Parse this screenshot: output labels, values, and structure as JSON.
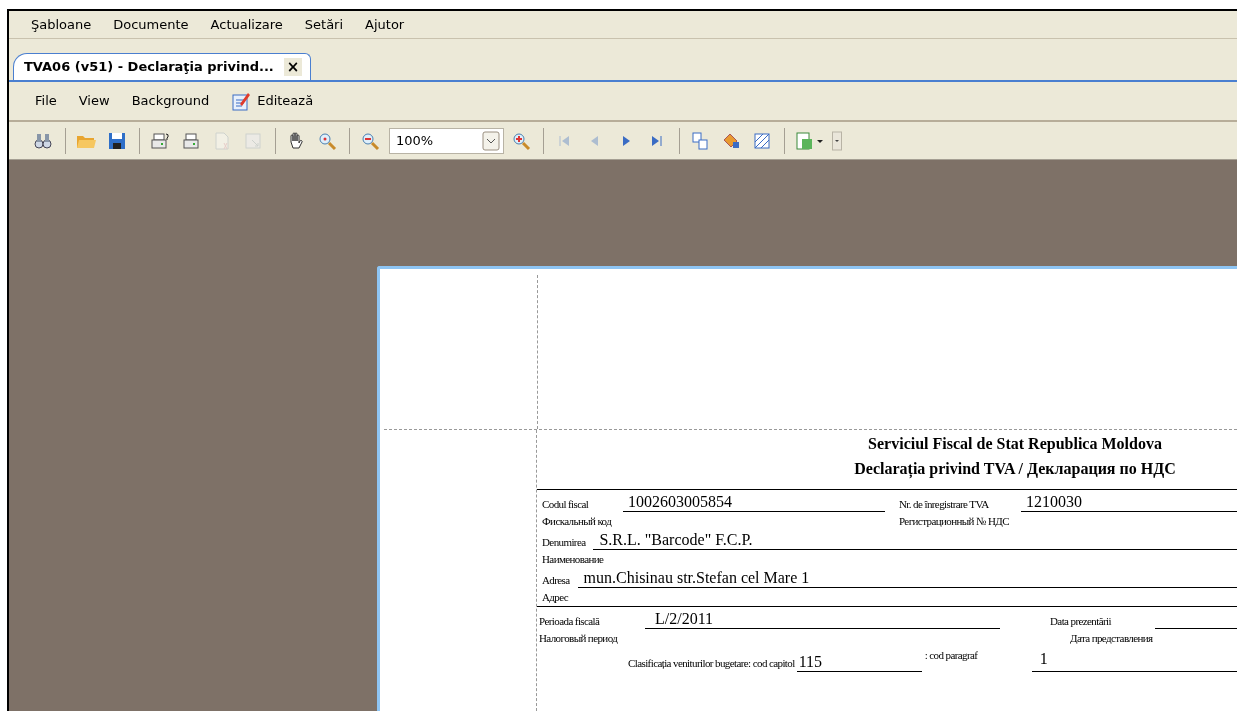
{
  "menu_bar": [
    "Şabloane",
    "Documente",
    "Actualizare",
    "Setări",
    "Ajutor"
  ],
  "tabs": [
    {
      "label": "TVA06 (v51) - Declaraţia privind...",
      "close": "×",
      "selected": true
    }
  ],
  "document_menu": [
    {
      "label": "File",
      "kind": "text"
    },
    {
      "label": "View",
      "kind": "text"
    },
    {
      "label": "Background",
      "kind": "text"
    },
    {
      "label": "Editează",
      "kind": "edit"
    }
  ],
  "toolbar": [
    {
      "kind": "binoculars",
      "disabled": false
    },
    {
      "kind": "separator"
    },
    {
      "kind": "folder",
      "disabled": false
    },
    {
      "kind": "save",
      "disabled": false
    },
    {
      "kind": "separator"
    },
    {
      "kind": "print-setup",
      "disabled": false
    },
    {
      "kind": "printer",
      "disabled": false
    },
    {
      "kind": "page-setup",
      "disabled": true
    },
    {
      "kind": "resize",
      "disabled": true
    },
    {
      "kind": "separator"
    },
    {
      "kind": "hand",
      "disabled": false
    },
    {
      "kind": "zoom",
      "disabled": false
    },
    {
      "kind": "separator"
    },
    {
      "kind": "zoom-out",
      "disabled": false
    },
    {
      "kind": "zoom-field",
      "value": "100%"
    },
    {
      "kind": "zoom-in",
      "disabled": false
    },
    {
      "kind": "separator"
    },
    {
      "kind": "first",
      "disabled": true
    },
    {
      "kind": "prev",
      "disabled": true
    },
    {
      "kind": "next",
      "disabled": false
    },
    {
      "kind": "last",
      "disabled": false
    },
    {
      "kind": "separator"
    },
    {
      "kind": "layout",
      "disabled": false
    },
    {
      "kind": "paint",
      "disabled": false
    },
    {
      "kind": "hatch",
      "disabled": false
    },
    {
      "kind": "separator"
    },
    {
      "kind": "export",
      "disabled": false
    },
    {
      "kind": "overflow",
      "disabled": false
    }
  ],
  "form": {
    "heading": [
      "Serviciul Fiscal de Stat Republica Moldova",
      "Declarația privind TVA / Декларация по НДС"
    ],
    "rows": [
      {
        "kind": "pair",
        "label": "Codul fiscal",
        "value": "1002603005854",
        "label2": "Nr. de înregistrare TVA",
        "value2": "1210030",
        "sub": "Фискальный код",
        "sub2": "Регистрационный № НДС"
      },
      {
        "kind": "single",
        "label": "Denumirea",
        "value": "S.R.L. \"Barcode\" F.C.P.",
        "sub": "Наименование"
      },
      {
        "kind": "single",
        "label": "Adresa",
        "value": "mun.Chisinau str.Stefan cel Mare 1",
        "sub": "Адрес"
      },
      {
        "kind": "period",
        "label": "Perioada fiscală",
        "value": "L/2/2011",
        "label2": "Data prezentării",
        "sub": "Налоговый период",
        "sub2": "Дата представления"
      },
      {
        "kind": "codes",
        "label": "Clasificația veniturilor bugetare: cod capitol",
        "value": "115",
        "label2": ": cod paragraf",
        "value2": "1"
      }
    ]
  }
}
